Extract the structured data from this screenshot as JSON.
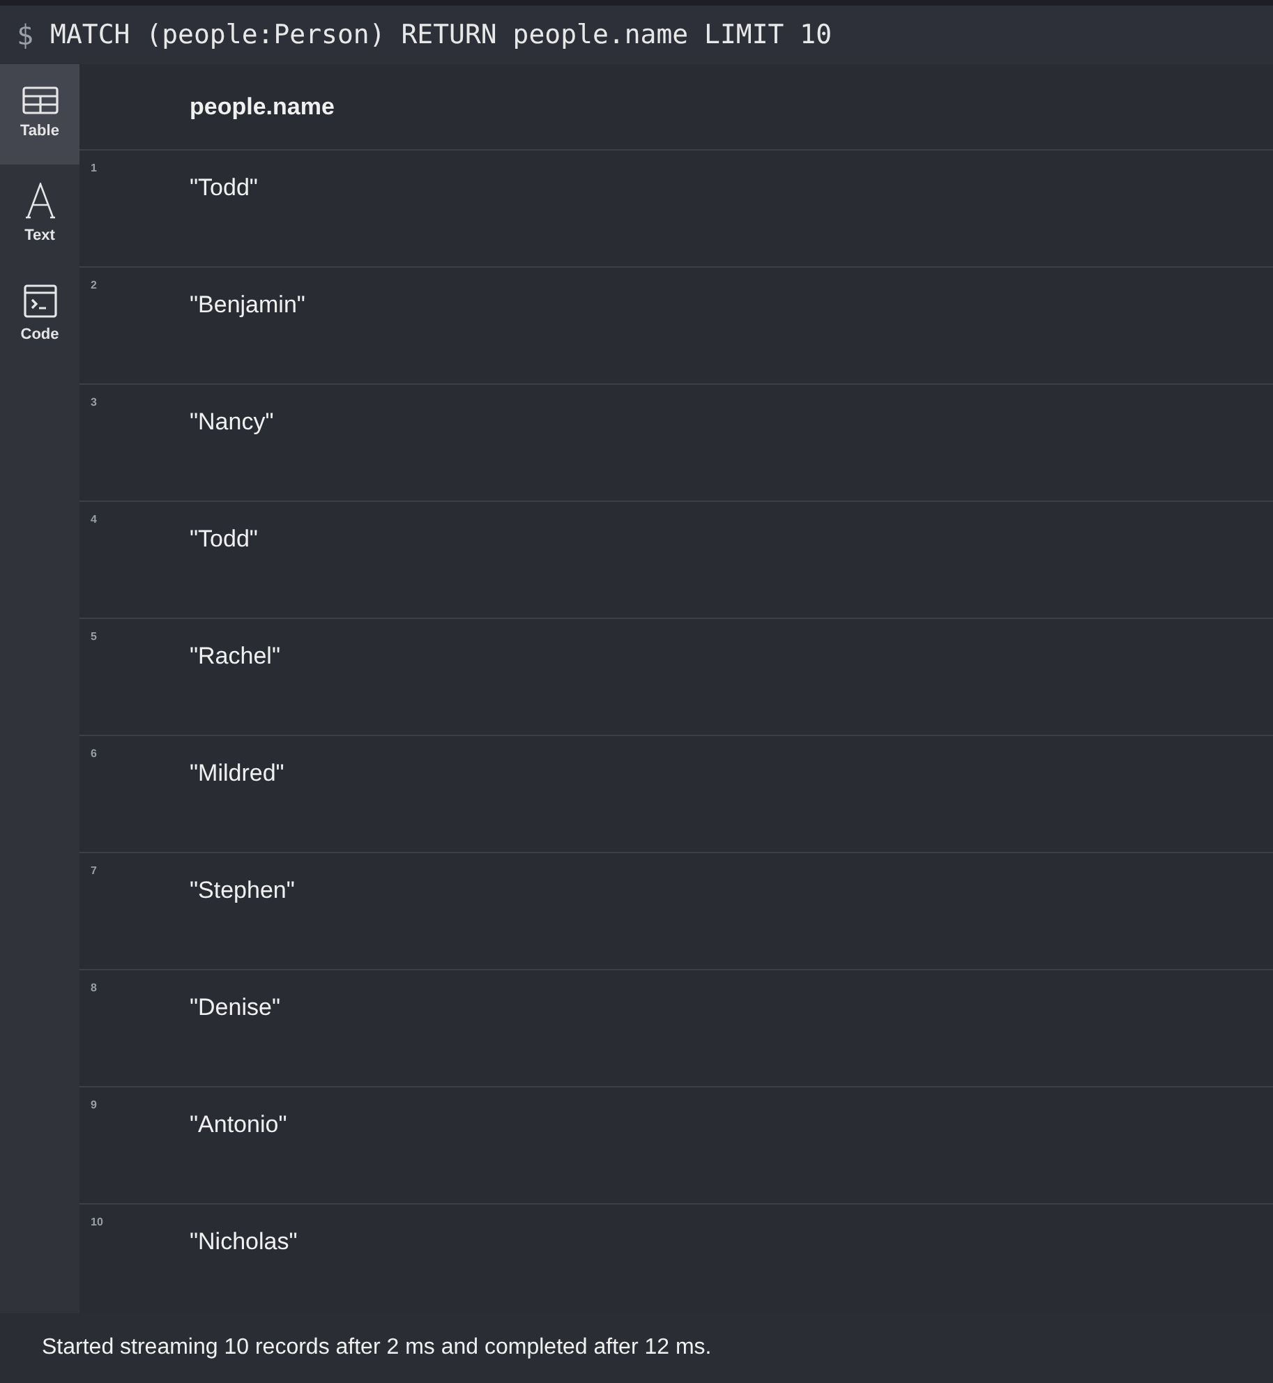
{
  "query": {
    "prompt": "$",
    "text": "MATCH (people:Person) RETURN people.name LIMIT 10"
  },
  "views": [
    {
      "kind": "table",
      "label": "Table",
      "selected": true
    },
    {
      "kind": "text",
      "label": "Text",
      "selected": false
    },
    {
      "kind": "code",
      "label": "Code",
      "selected": false
    }
  ],
  "table": {
    "columns": [
      "people.name"
    ],
    "rows": [
      {
        "index": "1",
        "cells": [
          "\"Todd\""
        ]
      },
      {
        "index": "2",
        "cells": [
          "\"Benjamin\""
        ]
      },
      {
        "index": "3",
        "cells": [
          "\"Nancy\""
        ]
      },
      {
        "index": "4",
        "cells": [
          "\"Todd\""
        ]
      },
      {
        "index": "5",
        "cells": [
          "\"Rachel\""
        ]
      },
      {
        "index": "6",
        "cells": [
          "\"Mildred\""
        ]
      },
      {
        "index": "7",
        "cells": [
          "\"Stephen\""
        ]
      },
      {
        "index": "8",
        "cells": [
          "\"Denise\""
        ]
      },
      {
        "index": "9",
        "cells": [
          "\"Antonio\""
        ]
      },
      {
        "index": "10",
        "cells": [
          "\"Nicholas\""
        ]
      }
    ]
  },
  "status_bar": "Started streaming 10 records after 2 ms and completed after 12 ms."
}
